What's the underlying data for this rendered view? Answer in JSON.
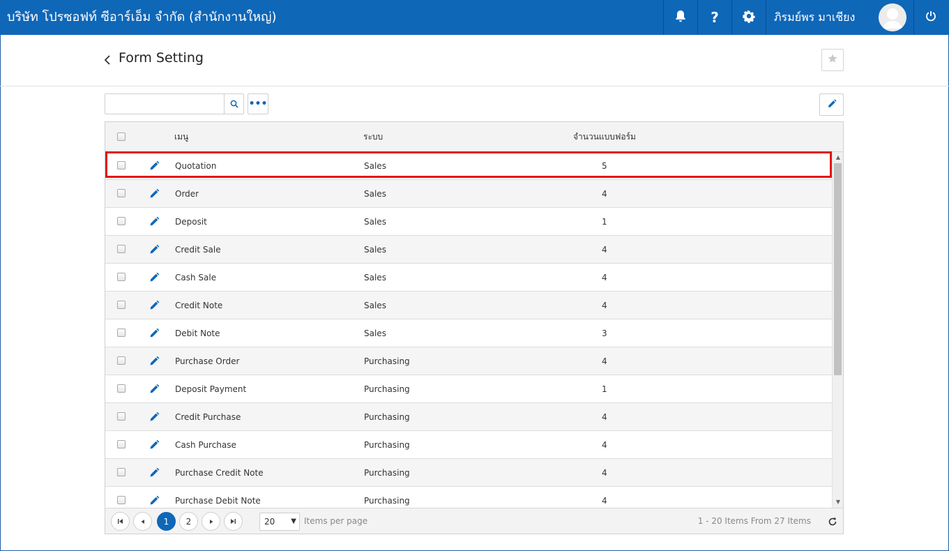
{
  "app": {
    "company_name": "บริษัท โปรซอฟท์ ซีอาร์เอ็ม จำกัด (สำนักงานใหญ่)",
    "user_name": "ภิรมย์พร มาเชียง",
    "accent_color": "#0f67b8",
    "icons": [
      "bell-icon",
      "help-icon",
      "gear-icon",
      "avatar",
      "power-icon"
    ]
  },
  "page": {
    "title": "Form Setting",
    "back_icon": "chevron-left-icon",
    "favorite_icon": "star-icon"
  },
  "toolbar": {
    "search_value": "",
    "search_icon": "search-icon",
    "more_icon": "more-icon",
    "more_label": "•••",
    "edit_icon": "pencil-icon"
  },
  "grid": {
    "columns": {
      "menu": "เมนู",
      "system": "ระบบ",
      "form_count": "จำนวนแบบฟอร์ม"
    },
    "rows": [
      {
        "menu": "Quotation",
        "system": "Sales",
        "count": "5"
      },
      {
        "menu": "Order",
        "system": "Sales",
        "count": "4"
      },
      {
        "menu": "Deposit",
        "system": "Sales",
        "count": "1"
      },
      {
        "menu": "Credit Sale",
        "system": "Sales",
        "count": "4"
      },
      {
        "menu": "Cash Sale",
        "system": "Sales",
        "count": "4"
      },
      {
        "menu": "Credit Note",
        "system": "Sales",
        "count": "4"
      },
      {
        "menu": "Debit Note",
        "system": "Sales",
        "count": "3"
      },
      {
        "menu": "Purchase Order",
        "system": "Purchasing",
        "count": "4"
      },
      {
        "menu": "Deposit Payment",
        "system": "Purchasing",
        "count": "1"
      },
      {
        "menu": "Credit Purchase",
        "system": "Purchasing",
        "count": "4"
      },
      {
        "menu": "Cash Purchase",
        "system": "Purchasing",
        "count": "4"
      },
      {
        "menu": "Purchase Credit Note",
        "system": "Purchasing",
        "count": "4"
      },
      {
        "menu": "Purchase Debit Note",
        "system": "Purchasing",
        "count": "4"
      }
    ],
    "highlighted_row": 0,
    "highlight_color": "#e31212"
  },
  "pager": {
    "pages": [
      "1",
      "2"
    ],
    "current_page": "1",
    "page_size": "20",
    "items_per_page_label": "Items per page",
    "info": "1 - 20 Items From 27 Items"
  }
}
